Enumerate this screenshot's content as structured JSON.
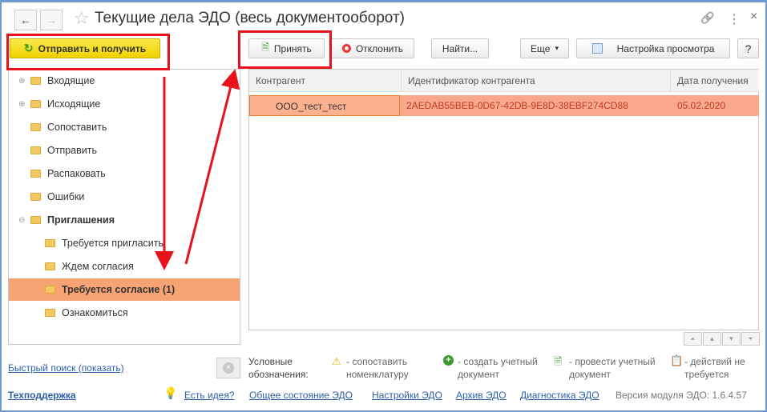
{
  "window": {
    "title": "Текущие дела ЭДО (весь документооборот)",
    "back": "←",
    "forward": "→",
    "star": "☆",
    "link": "🔗",
    "more": "⋮",
    "close": "×"
  },
  "toolbar": {
    "send_receive": "Отправить и получить",
    "accept": "Принять",
    "reject": "Отклонить",
    "find": "Найти...",
    "more": "Еще",
    "more_arrow": "▾",
    "view_settings": "Настройка просмотра",
    "help": "?"
  },
  "tree": [
    {
      "label": "Входящие",
      "expander": "⊕",
      "level": 0,
      "bold": false
    },
    {
      "label": "Исходящие",
      "expander": "⊕",
      "level": 0,
      "bold": false
    },
    {
      "label": "Сопоставить",
      "level": 0
    },
    {
      "label": "Отправить",
      "level": 0
    },
    {
      "label": "Распаковать",
      "level": 0
    },
    {
      "label": "Ошибки",
      "level": 0
    },
    {
      "label": "Приглашения",
      "expander": "⊖",
      "level": 0,
      "bold": true
    },
    {
      "label": "Требуется пригласить",
      "level": 1
    },
    {
      "label": "Ждем согласия",
      "level": 1
    },
    {
      "label": "Требуется согласие (1)",
      "level": 1,
      "bold": true,
      "selected": true
    },
    {
      "label": "Ознакомиться",
      "level": 1
    }
  ],
  "table": {
    "columns": [
      "Контрагент",
      "Идентификатор контрагента",
      "Дата получения"
    ],
    "rows": [
      [
        "ООО_тест_тест",
        "2AEDAB55BEB-0D67-42DB-9E8D-38EBF274CD88",
        "05.02.2020"
      ]
    ]
  },
  "scroll": [
    "⏶",
    "▲",
    "▼",
    "⏷"
  ],
  "quick_search": "Быстрый поиск (показать)",
  "legend": {
    "title": "Условные обозначения:",
    "items": [
      "- сопоставить номенклатуру",
      "- создать учетный документ",
      "- провести учетный документ",
      "- действий не требуется"
    ]
  },
  "footer": {
    "support": "Техподдержка",
    "idea": "Есть идея?",
    "status": "Общее состояние ЭДО",
    "settings": "Настройки ЭДО",
    "archive": "Архив ЭДО",
    "diagnostics": "Диагностика ЭДО",
    "version": "Версия модуля ЭДО: 1.6.4.57"
  },
  "colors": {
    "selected": "#f9a98b",
    "accent_yellow": "#f5d800",
    "annotation": "#e8121b"
  }
}
